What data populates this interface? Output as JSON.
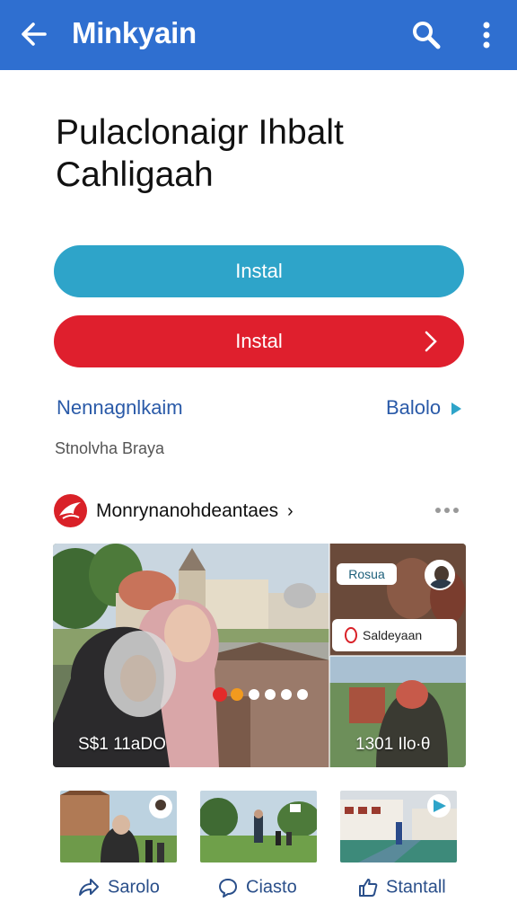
{
  "appbar": {
    "title": "Minkyain",
    "back_icon": "arrow-left-icon",
    "search_icon": "search-icon",
    "more_icon": "more-vertical-icon",
    "color": "#2f6fd0"
  },
  "heading": "Pulaclonaigr Ihbalt Cahligaah",
  "buttons": {
    "primary_label": "Instal",
    "primary_color": "#2ea4c9",
    "secondary_label": "Instal",
    "secondary_color": "#df1f2d"
  },
  "links": {
    "left": "Nennagnlkaim",
    "right": "Balolo"
  },
  "subtext": "Stnolvha Braya",
  "channel": {
    "name": "Monrynanohdeantaes",
    "chevron": "›"
  },
  "media": {
    "caption_left": "S$1 11aDO",
    "caption_right": "1301 Ilo∙θ",
    "badge_top": "Rosua",
    "badge_mid": "Saldeyaan"
  },
  "thumbnails": [
    {
      "label": "Sarolo",
      "icon": "share-icon"
    },
    {
      "label": "Ciasto",
      "icon": "chat-icon"
    },
    {
      "label": "Stantall",
      "icon": "thumbs-up-icon"
    }
  ]
}
